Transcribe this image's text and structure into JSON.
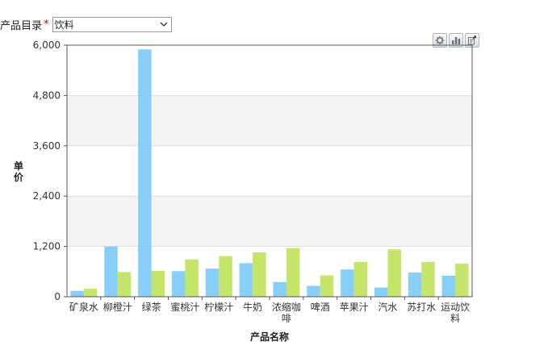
{
  "filter": {
    "label": "产品目录",
    "required_mark": "*",
    "selected": "饮料"
  },
  "toolbar": {
    "icons": [
      "gear-icon",
      "bar-chart-icon",
      "export-icon"
    ]
  },
  "colors": {
    "series_a": "#87cefa",
    "series_b": "#c4e56a",
    "band": "#f3f3f3",
    "axis": "#555555"
  },
  "chart_data": {
    "type": "bar",
    "title": "",
    "xlabel": "产品名称",
    "ylabel": "单价",
    "ylim": [
      0,
      6000
    ],
    "yticks": [
      "0",
      "1,200",
      "2,400",
      "3,600",
      "4,800",
      "6,000"
    ],
    "ytick_values": [
      0,
      1200,
      2400,
      3600,
      4800,
      6000
    ],
    "grid": true,
    "legend": "none",
    "categories": [
      "矿泉水",
      "柳橙汁",
      "绿茶",
      "蜜桃汁",
      "柠檬汁",
      "牛奶",
      "浓缩咖啡",
      "啤酒",
      "苹果汁",
      "汽水",
      "苏打水",
      "运动饮料"
    ],
    "series": [
      {
        "values": [
          140,
          1200,
          5900,
          610,
          670,
          800,
          350,
          260,
          650,
          220,
          580,
          500
        ]
      },
      {
        "values": [
          190,
          590,
          620,
          890,
          970,
          1060,
          1160,
          510,
          830,
          1130,
          830,
          790
        ]
      }
    ]
  }
}
